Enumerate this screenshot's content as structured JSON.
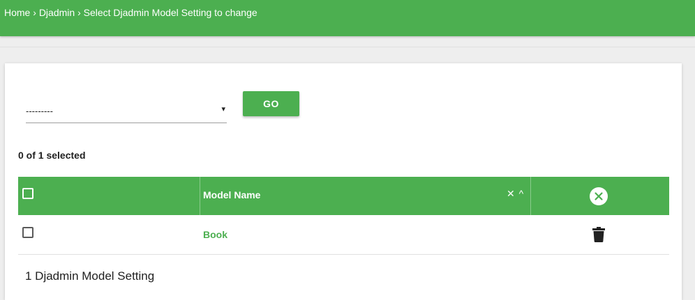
{
  "breadcrumb": {
    "home": "Home",
    "sep1": "›",
    "app": "Djadmin",
    "sep2": "›",
    "current": "Select Djadmin Model Setting to change"
  },
  "actions": {
    "select_value": "---------",
    "caret": "▾",
    "go_label": "GO"
  },
  "selection": {
    "count_text": "0 of 1 selected"
  },
  "table": {
    "columns": [
      {
        "label": "Model Name"
      }
    ],
    "sort": {
      "remove_glyph": "✕",
      "toggle_glyph": "^"
    },
    "rows": [
      {
        "model_name": "Book"
      }
    ]
  },
  "footer": {
    "count_text": "1 Djadmin Model Setting"
  },
  "colors": {
    "accent": "#4caf50",
    "background": "#eeeeee"
  },
  "icons": {
    "clear": "close-circle-icon",
    "delete": "trash-icon"
  }
}
